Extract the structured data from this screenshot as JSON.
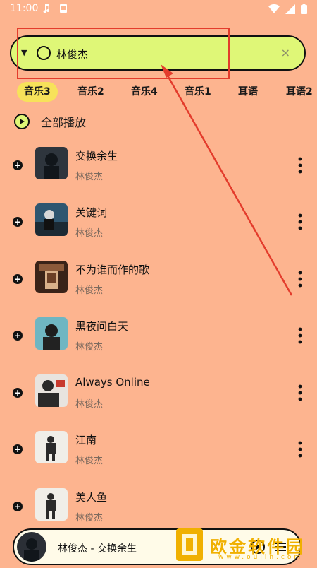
{
  "status_bar": {
    "time": "11:00",
    "icons_left": [
      "music-note-icon",
      "gallery-icon"
    ],
    "icons_right": [
      "wifi-icon",
      "cellular-icon",
      "battery-icon"
    ]
  },
  "search": {
    "value": "林俊杰",
    "clear_glyph": "×"
  },
  "tabs": [
    {
      "label": "音乐3",
      "active": true
    },
    {
      "label": "音乐2",
      "active": false
    },
    {
      "label": "音乐4",
      "active": false
    },
    {
      "label": "音乐1",
      "active": false
    },
    {
      "label": "耳语",
      "active": false
    },
    {
      "label": "耳语2",
      "active": false
    }
  ],
  "play_all": {
    "label": "全部播放"
  },
  "songs": [
    {
      "title": "交换余生",
      "artist": "林俊杰"
    },
    {
      "title": "关键词",
      "artist": "林俊杰"
    },
    {
      "title": "不为谁而作的歌",
      "artist": "林俊杰"
    },
    {
      "title": "黑夜问白天",
      "artist": "林俊杰"
    },
    {
      "title": "Always Online",
      "artist": "林俊杰"
    },
    {
      "title": "江南",
      "artist": "林俊杰"
    },
    {
      "title": "美人鱼",
      "artist": "林俊杰"
    }
  ],
  "mini_player": {
    "now_playing": "林俊杰 - 交换余生"
  },
  "watermark": {
    "text": "欧金软件园",
    "url": "www.oujin.com"
  },
  "colors": {
    "background": "#fdb48f",
    "search_bg": "#dff777",
    "active_tab": "#f7e25a",
    "annotation": "#e33c2c"
  }
}
